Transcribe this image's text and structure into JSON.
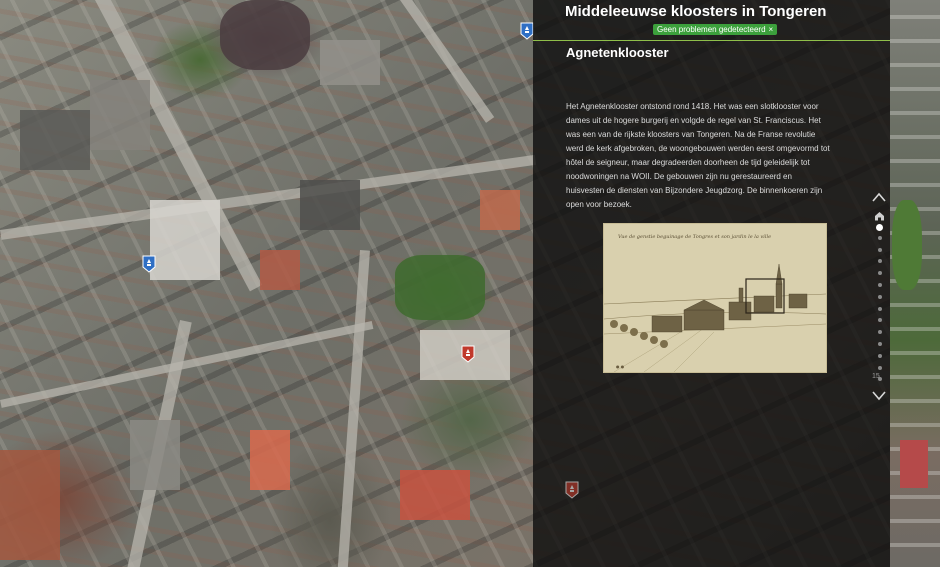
{
  "app": {
    "title": "Middeleeuwse kloosters in Tongeren",
    "status_badge": "Geen problemen gedetecteerd",
    "status_close": "×"
  },
  "section": {
    "title": "Agnetenklooster",
    "body": "Het Agnetenklooster ontstond rond 1418. Het was een slotklooster voor dames uit de hogere burgerij en volgde de regel van St. Franciscus. Het was een van de rijkste kloosters van Tongeren. Na de Franse revolutie werd de kerk afgebroken, de woongebouwen werden eerst omgevormd tot hôtel de seigneur, maar degradeerden doorheen de tijd geleidelijk tot noodwoningen na WOII. De gebouwen zijn nu gerestaureerd en huisvesten de diensten van Bijzondere Jeugdzorg. De binnenkoeren zijn open voor bezoek."
  },
  "figure": {
    "caption_script": "Vue de genstie beguinage de Tongres et son jardin le la ville"
  },
  "navigation": {
    "dot_count": 15,
    "active_index": 0,
    "last_label": "15",
    "icons": [
      "chevron-up-icon",
      "home-icon",
      "chevron-down-icon"
    ]
  },
  "markers": [
    {
      "name": "map-marker-blue-1",
      "color": "#2f6fc4"
    },
    {
      "name": "map-marker-blue-2",
      "color": "#2f6fc4"
    },
    {
      "name": "map-marker-red-1",
      "color": "#c0392b"
    },
    {
      "name": "map-marker-red-2",
      "color": "#c0392b"
    }
  ],
  "colors": {
    "accent_line": "#8fbf4a",
    "badge_bg": "#3ca03c",
    "panel_bg": "#0a0a0a"
  }
}
